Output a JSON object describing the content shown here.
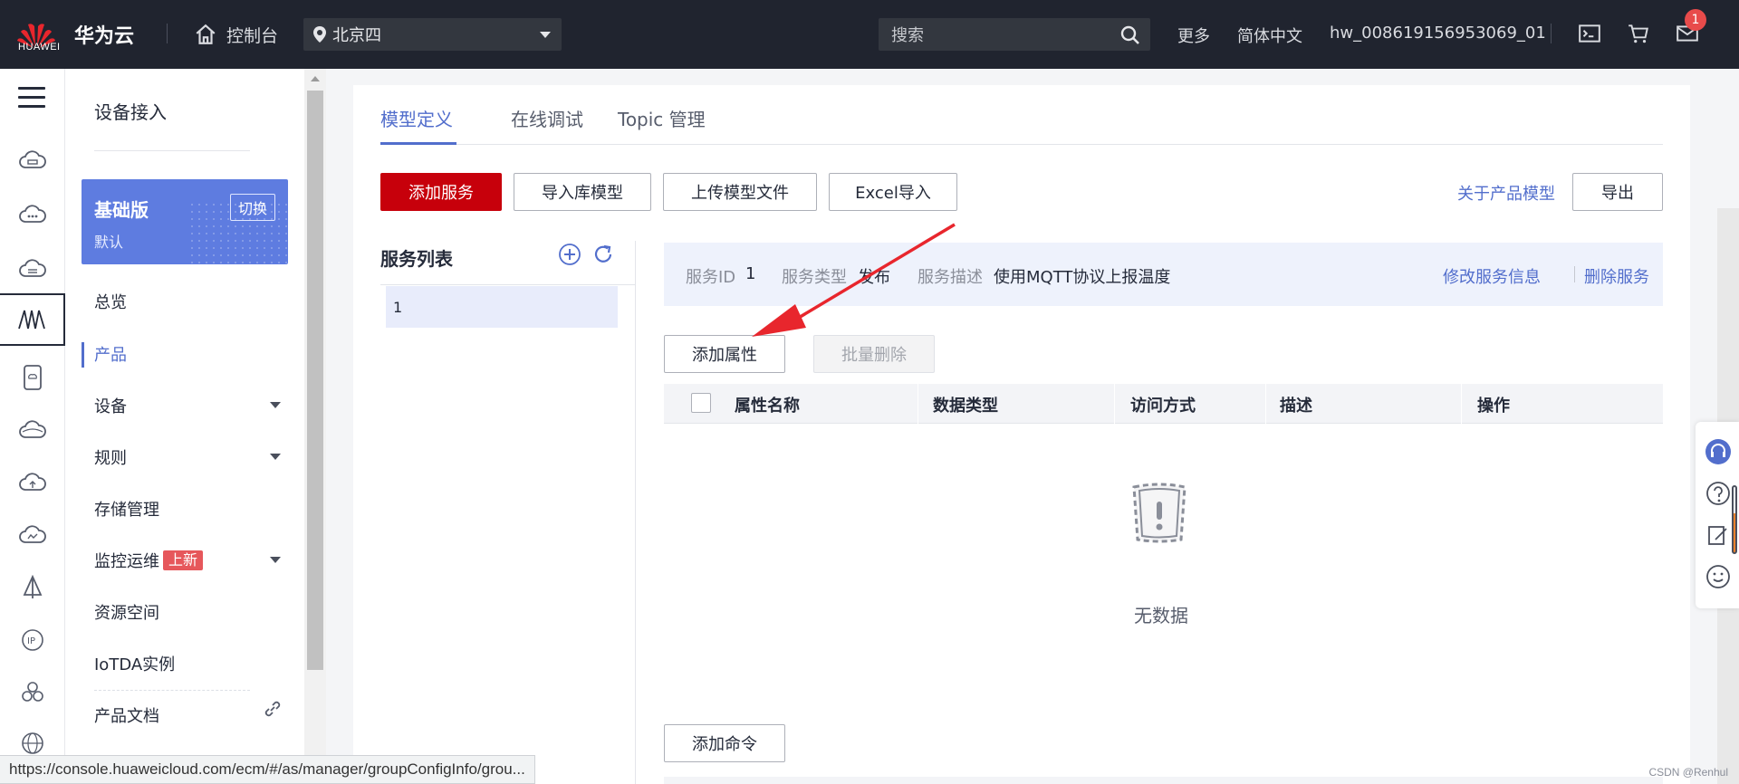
{
  "header": {
    "logo_text": "HUAWEI",
    "brand": "华为云",
    "console_label": "控制台",
    "region": "北京四",
    "search_placeholder": "搜索",
    "more": "更多",
    "language": "简体中文",
    "username": "hw_008619156953069_01",
    "mail_badge": "1"
  },
  "sidebar": {
    "title": "设备接入",
    "edition": {
      "name": "基础版",
      "switch_label": "切换",
      "sub": "默认"
    },
    "items": [
      {
        "label": "总览"
      },
      {
        "label": "产品",
        "active": true
      },
      {
        "label": "设备",
        "expandable": true
      },
      {
        "label": "规则",
        "expandable": true
      },
      {
        "label": "存储管理"
      },
      {
        "label": "监控运维",
        "badge": "上新",
        "expandable": true
      },
      {
        "label": "资源空间"
      },
      {
        "label": "IoTDA实例"
      },
      {
        "label": "产品文档"
      }
    ]
  },
  "main": {
    "tabs": [
      {
        "label": "模型定义",
        "active": true
      },
      {
        "label": "在线调试"
      },
      {
        "label": "Topic 管理"
      }
    ],
    "toolbar": {
      "add_service": "添加服务",
      "import_library": "导入库模型",
      "upload_model": "上传模型文件",
      "excel_import": "Excel导入",
      "about_model": "关于产品模型",
      "export": "导出"
    },
    "service_list": {
      "title": "服务列表",
      "items": [
        "1"
      ]
    },
    "service_info": {
      "id_label": "服务ID",
      "id_value": "1",
      "type_label": "服务类型",
      "type_value": "发布",
      "desc_label": "服务描述",
      "desc_value": "使用MQTT协议上报温度",
      "edit": "修改服务信息",
      "delete": "删除服务"
    },
    "property_actions": {
      "add_property": "添加属性",
      "batch_delete": "批量删除"
    },
    "table": {
      "columns": [
        "属性名称",
        "数据类型",
        "访问方式",
        "描述",
        "操作"
      ],
      "empty_text": "无数据"
    },
    "add_command": "添加命令"
  },
  "status_url": "https://console.huaweicloud.com/ecm/#/as/manager/groupConfigInfo/grou...",
  "watermark": "CSDN @Renhul",
  "colors": {
    "header_bg": "#20242f",
    "primary_red": "#c7000b",
    "accent_blue": "#526ecc",
    "edition_bg": "#5e7ce0",
    "arrow_red": "#e8262d"
  }
}
